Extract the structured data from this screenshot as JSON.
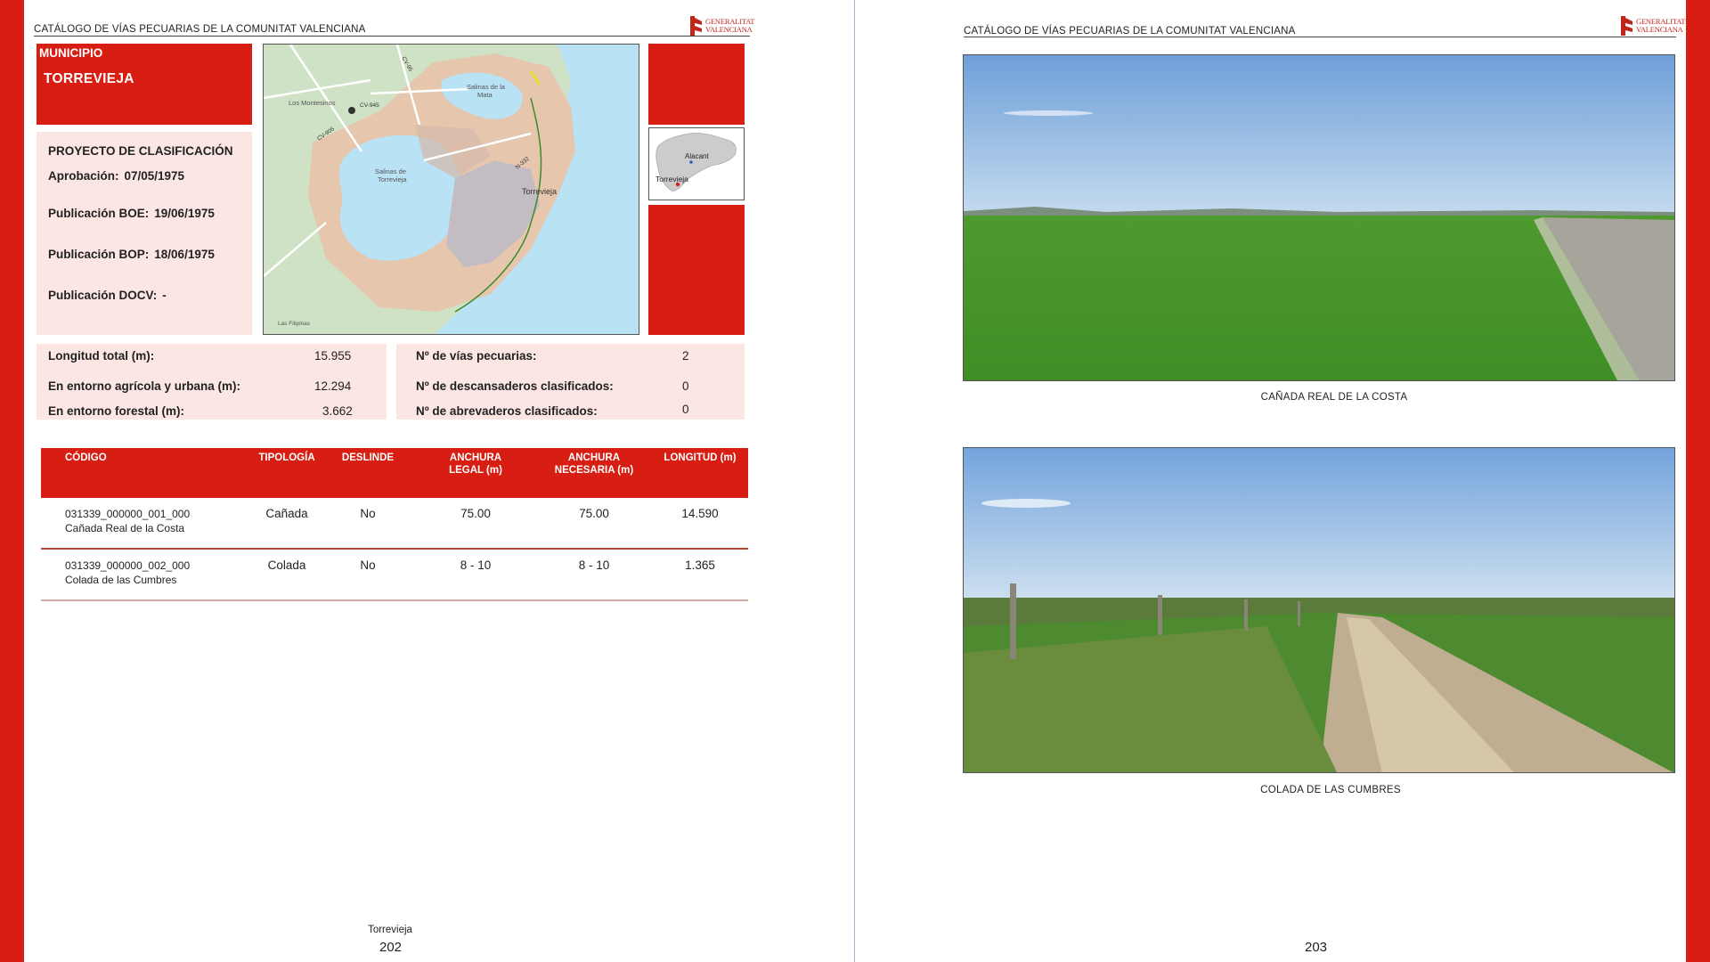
{
  "header": {
    "title": "CATÁLOGO DE VÍAS PECUARIAS DE LA COMUNITAT VALENCIANA",
    "logo_line1": "GENERALITAT",
    "logo_line2": "VALENCIANA"
  },
  "left_page": {
    "municipio_label": "MUNICIPIO",
    "municipio_name": "TORREVIEJA",
    "proyecto": {
      "title": "PROYECTO DE CLASIFICACIÓN",
      "aprobacion_label": "Aprobación:",
      "aprobacion_value": "07/05/1975",
      "boe_label": "Publicación BOE:",
      "boe_value": "19/06/1975",
      "bop_label": "Publicación BOP:",
      "bop_value": "18/06/1975",
      "docv_label": "Publicación DOCV:",
      "docv_value": "-"
    },
    "map_labels": {
      "salinas_mata": [
        "Salinas de la",
        "Mata"
      ],
      "salinas_torrevieja": [
        "Salinas de",
        "Torrevieja"
      ],
      "montesinos": "Los Montesinos",
      "torrevieja": "Torrevieja",
      "road_cv945": "CV-945",
      "road_cv95": "CV-95",
      "road_cv905": "CV-905",
      "road_n332": "N-332",
      "filipinas": "Las Filipinas"
    },
    "inset_labels": {
      "province": "Alacant",
      "town": "Torrevieja"
    },
    "stats_left": {
      "longitud_label": "Longitud total (m):",
      "longitud_value": "15.955",
      "agricola_label": "En entorno agrícola y urbana (m):",
      "agricola_value": "12.294",
      "forestal_label": "En entorno forestal (m):",
      "forestal_value": "3.662"
    },
    "stats_right": {
      "vias_label": "Nº de vías pecuarias:",
      "vias_value": "2",
      "descansaderos_label": "Nº de descansaderos clasificados:",
      "descansaderos_value": "0",
      "abrevaderos_label": "Nº de abrevaderos clasificados:",
      "abrevaderos_value": "0"
    },
    "table": {
      "headers": {
        "codigo": "CÓDIGO",
        "tipologia": "TIPOLOGÍA",
        "deslinde": "DESLINDE",
        "anchura_legal_1": "ANCHURA",
        "anchura_legal_2": "LEGAL (m)",
        "anchura_nec_1": "ANCHURA",
        "anchura_nec_2": "NECESARIA (m)",
        "longitud": "LONGITUD (m)"
      },
      "rows": [
        {
          "code": "031339_000000_001_000",
          "name": "Cañada Real de la Costa",
          "tipologia": "Cañada",
          "deslinde": "No",
          "anchura_legal": "75.00",
          "anchura_necesaria": "75.00",
          "longitud": "14.590"
        },
        {
          "code": "031339_000000_002_000",
          "name": "Colada de las Cumbres",
          "tipologia": "Colada",
          "deslinde": "No",
          "anchura_legal": "8 - 10",
          "anchura_necesaria": "8 - 10",
          "longitud": "1.365"
        }
      ]
    },
    "footer_town": "Torrevieja",
    "page_number": "202"
  },
  "right_page": {
    "photo1_caption": "CAÑADA REAL DE LA COSTA",
    "photo2_caption": "COLADA DE LAS CUMBRES",
    "page_number": "203"
  },
  "colors": {
    "brand_red": "#d81e12",
    "pink_panel": "#fbe6e4"
  }
}
